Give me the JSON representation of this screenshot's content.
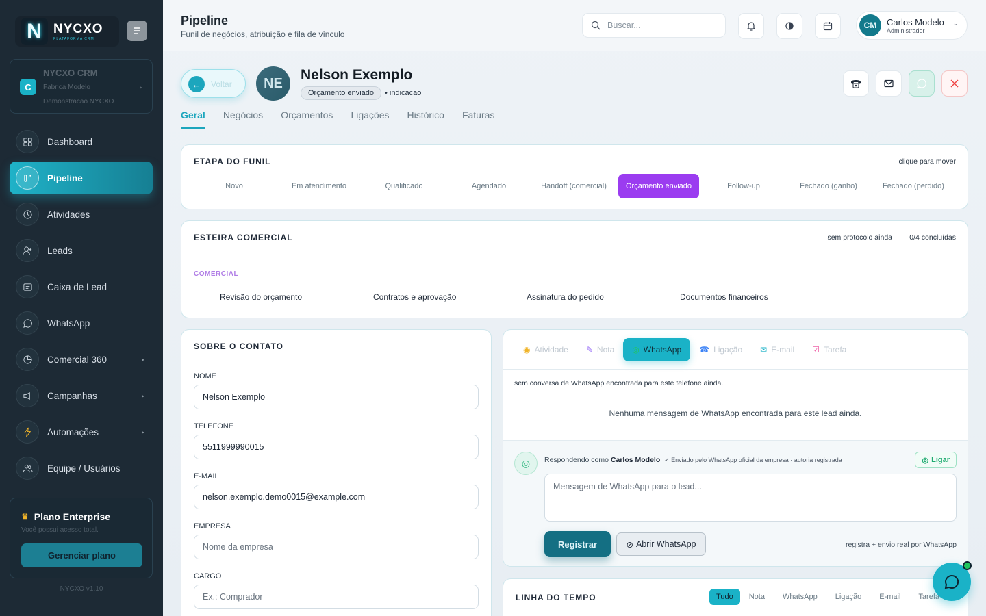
{
  "sidebar": {
    "logo_text": "NYCXO",
    "logo_letter": "N",
    "logo_subtitle": "PLATAFORMA CRM",
    "company": {
      "icon_letter": "C",
      "title": "NYCXO CRM",
      "subtitle1": "Fabrica Modelo",
      "subtitle2": "Demonstracao NYCXO"
    },
    "items": [
      {
        "label": "Dashboard",
        "icon": "grid-icon"
      },
      {
        "label": "Pipeline",
        "icon": "pipeline-icon"
      },
      {
        "label": "Atividades",
        "icon": "clock-icon"
      },
      {
        "label": "Leads",
        "icon": "user-plus-icon"
      },
      {
        "label": "Caixa de Lead",
        "icon": "inbox-icon"
      },
      {
        "label": "WhatsApp",
        "icon": "chat-icon"
      },
      {
        "label": "Comercial 360",
        "icon": "chart-icon"
      },
      {
        "label": "Campanhas",
        "icon": "megaphone-icon"
      },
      {
        "label": "Automações",
        "icon": "bolt-icon"
      },
      {
        "label": "Equipe / Usuários",
        "icon": "users-icon"
      }
    ],
    "plan": {
      "title": "Plano Enterprise",
      "subtitle": "Você possui acesso total.",
      "button": "Gerenciar plano"
    },
    "version": "NYCXO v1.10"
  },
  "topbar": {
    "title": "Pipeline",
    "subtitle": "Funil de negócios, atribuição e fila de vínculo",
    "search_placeholder": "Buscar...",
    "user": {
      "initials": "CM",
      "name": "Carlos Modelo",
      "role": "Administrador"
    }
  },
  "lead": {
    "back_label": "Voltar",
    "initials": "NE",
    "name": "Nelson Exemplo",
    "stage_badge": "Orçamento enviado",
    "origin": "• indicacao"
  },
  "tabs": [
    "Geral",
    "Negócios",
    "Orçamentos",
    "Ligações",
    "Histórico",
    "Faturas"
  ],
  "funnel": {
    "title": "ETAPA DO FUNIL",
    "hint": "clique para mover",
    "stages": [
      "Novo",
      "Em atendimento",
      "Qualificado",
      "Agendado",
      "Handoff (comercial)",
      "Orçamento enviado",
      "Follow-up",
      "Fechado (ganho)",
      "Fechado (perdido)"
    ],
    "active_stage": "Orçamento enviado",
    "active_color": "#9b3cf0"
  },
  "esteira": {
    "title": "ESTEIRA COMERCIAL",
    "protocol_note": "sem protocolo ainda",
    "progress": "0/4 concluídas",
    "section_label": "COMERCIAL",
    "steps": [
      "Revisão do orçamento",
      "Contratos e aprovação",
      "Assinatura do pedido",
      "Documentos financeiros"
    ]
  },
  "contact": {
    "title": "SOBRE O CONTATO",
    "fields": [
      {
        "label": "NOME",
        "value": "Nelson Exemplo",
        "placeholder": ""
      },
      {
        "label": "TELEFONE",
        "value": "5511999990015",
        "placeholder": ""
      },
      {
        "label": "E-MAIL",
        "value": "nelson.exemplo.demo0015@example.com",
        "placeholder": ""
      },
      {
        "label": "EMPRESA",
        "value": "",
        "placeholder": "Nome da empresa"
      },
      {
        "label": "CARGO",
        "value": "",
        "placeholder": "Ex.: Comprador"
      }
    ]
  },
  "comms": {
    "tabs": [
      {
        "label": "Atividade",
        "icon": "activity-icon",
        "color": "#f0b429"
      },
      {
        "label": "Nota",
        "icon": "pencil-icon",
        "color": "#8b5cf6"
      },
      {
        "label": "WhatsApp",
        "icon": "whatsapp-icon",
        "color": "#22c55e"
      },
      {
        "label": "Ligação",
        "icon": "phone-icon",
        "color": "#3b82f6"
      },
      {
        "label": "E-mail",
        "icon": "mail-icon",
        "color": "#1ab2c7"
      },
      {
        "label": "Tarefa",
        "icon": "checkbox-icon",
        "color": "#ec4899"
      }
    ],
    "active_tab": "WhatsApp",
    "no_conversation": "sem conversa de WhatsApp encontrada para este telefone ainda.",
    "no_messages": "Nenhuma mensagem de WhatsApp encontrada para este lead ainda.",
    "responding_prefix": "Respondendo como",
    "responding_user": "Carlos Modelo",
    "responding_note": "✓ Enviado pelo WhatsApp oficial da empresa · autoria registrada",
    "call_button": "Ligar",
    "message_placeholder": "Mensagem de WhatsApp para o lead...",
    "register_button": "Registrar",
    "open_whatsapp_button": "Abrir WhatsApp",
    "register_note": "registra + envio real por WhatsApp"
  },
  "timeline": {
    "title": "LINHA DO TEMPO",
    "filters": [
      "Tudo",
      "Nota",
      "WhatsApp",
      "Ligação",
      "E-mail",
      "Tarefa"
    ],
    "active_filter": "Tudo"
  }
}
